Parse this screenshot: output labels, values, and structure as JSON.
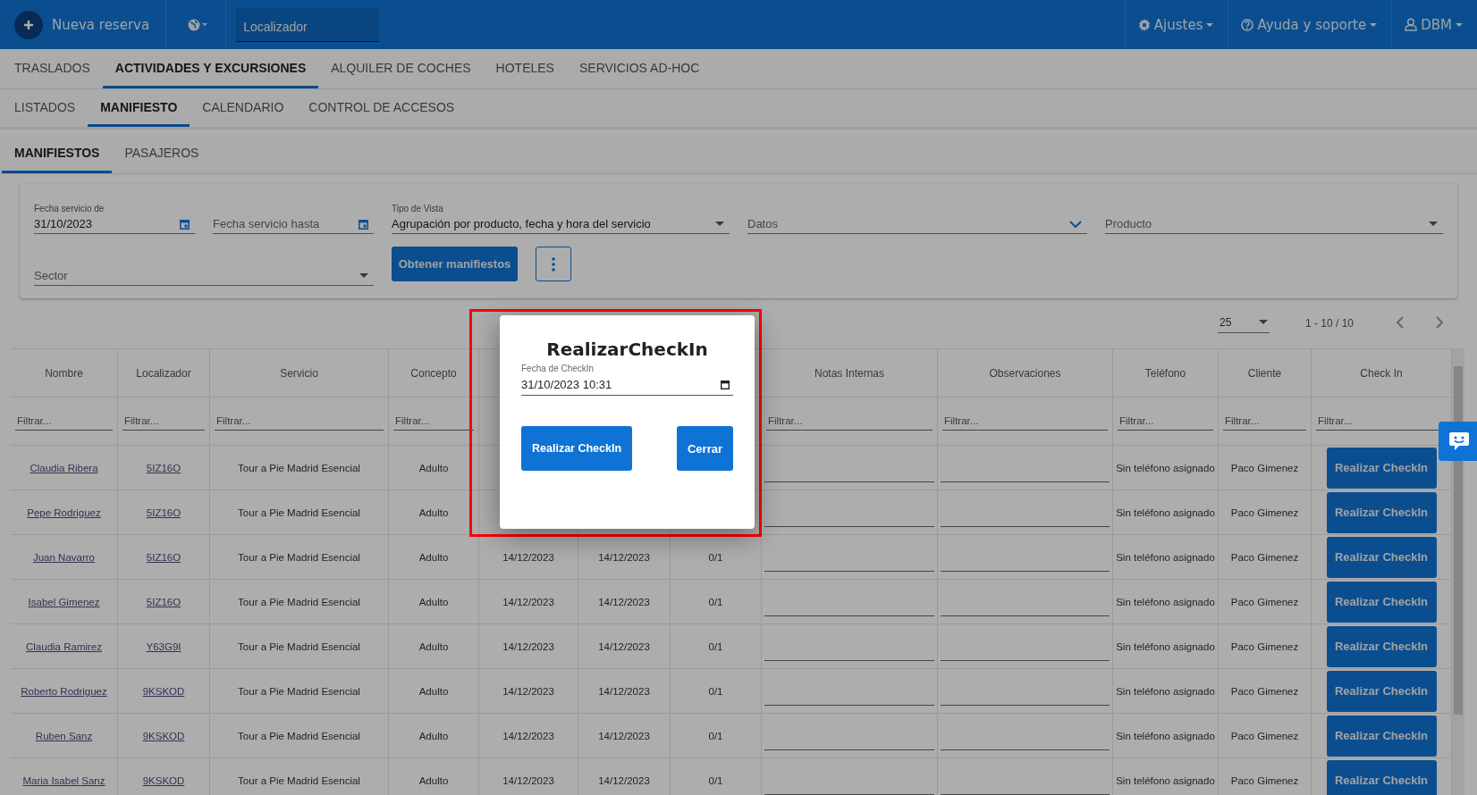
{
  "top_bar": {
    "new_button": "Nueva reserva",
    "search": {
      "placeholder": "Localizador"
    },
    "menus": [
      {
        "kind": "settings",
        "label": "Ajustes"
      },
      {
        "kind": "help",
        "label": "Ayuda y soporte"
      },
      {
        "kind": "user",
        "label": "DBM"
      }
    ]
  },
  "main_tabs": [
    {
      "label": "TRASLADOS",
      "selected": false
    },
    {
      "label": "ACTIVIDADES Y EXCURSIONES",
      "selected": true
    },
    {
      "label": "ALQUILER DE COCHES",
      "selected": false
    },
    {
      "label": "HOTELES",
      "selected": false
    },
    {
      "label": "SERVICIOS AD-HOC",
      "selected": false
    }
  ],
  "sub_tabs": [
    {
      "label": "LISTADOS",
      "selected": false
    },
    {
      "label": "MANIFIESTO",
      "selected": true
    },
    {
      "label": "CALENDARIO",
      "selected": false
    },
    {
      "label": "CONTROL DE ACCESOS",
      "selected": false
    }
  ],
  "section_tabs": [
    {
      "label": "MANIFIESTOS",
      "selected": true
    },
    {
      "label": "PASAJEROS",
      "selected": false
    }
  ],
  "filters": {
    "fields": [
      {
        "kind": "date",
        "label": "Fecha servicio de",
        "value": "31/10/2023"
      },
      {
        "kind": "date",
        "placeholder": "Fecha servicio hasta"
      },
      {
        "kind": "select",
        "label": "Tipo de Vista",
        "value": "Agrupación por producto, fecha y hora del servicio"
      },
      {
        "kind": "chevron",
        "placeholder": "Datos"
      },
      {
        "kind": "select",
        "placeholder": "Producto"
      },
      {
        "kind": "wide-select",
        "placeholder": "Sector"
      }
    ],
    "submit_button": "Obtener manifiestos"
  },
  "pagination": {
    "page_size": "25",
    "range": "1 - 10 / 10"
  },
  "table": {
    "columns_before": [
      {
        "heading": "Nombre",
        "filter_placeholder": "Filtrar..."
      },
      {
        "heading": "Localizador",
        "filter_placeholder": "Filtrar..."
      },
      {
        "heading": "Servicio",
        "filter_placeholder": "Filtrar..."
      },
      {
        "heading": "Concepto",
        "filter_placeholder": "Filtrar..."
      }
    ],
    "columns_after": [
      {
        "heading": "Notas Internas",
        "filter_placeholder": "Filtrar..."
      },
      {
        "heading": "Observaciones",
        "filter_placeholder": "Filtrar..."
      },
      {
        "heading": "Teléfono",
        "filter_placeholder": "Filtrar..."
      },
      {
        "heading": "Cliente",
        "filter_placeholder": "Filtrar..."
      },
      {
        "heading": "Check In",
        "filter_placeholder": "Filtrar..."
      }
    ],
    "rows": [
      {
        "nombre": "Claudia Ribera",
        "localizador": "5IZ16O",
        "servicio": "Tour a Pie Madrid Esencial",
        "concepto": "Adulto",
        "telefono": "Sin teléfono asignado",
        "cliente": "Paco Gimenez",
        "action": "Realizar CheckIn"
      },
      {
        "nombre": "Pepe Rodriguez",
        "localizador": "5IZ16O",
        "servicio": "Tour a Pie Madrid Esencial",
        "concepto": "Adulto",
        "telefono": "Sin teléfono asignado",
        "cliente": "Paco Gimenez",
        "action": "Realizar CheckIn"
      },
      {
        "nombre": "Juan Navarro",
        "localizador": "5IZ16O",
        "servicio": "Tour a Pie Madrid Esencial",
        "concepto": "Adulto",
        "column_5": "14/12/2023",
        "column_6": "14/12/2023",
        "column_7": "0/1",
        "telefono": "Sin teléfono asignado",
        "cliente": "Paco Gimenez",
        "action": "Realizar CheckIn"
      },
      {
        "nombre": "Isabel Gimenez",
        "localizador": "5IZ16O",
        "servicio": "Tour a Pie Madrid Esencial",
        "concepto": "Adulto",
        "column_5": "14/12/2023",
        "column_6": "14/12/2023",
        "column_7": "0/1",
        "telefono": "Sin teléfono asignado",
        "cliente": "Paco Gimenez",
        "action": "Realizar CheckIn"
      },
      {
        "nombre": "Claudia Ramirez",
        "localizador": "Y63G9I",
        "servicio": "Tour a Pie Madrid Esencial",
        "concepto": "Adulto",
        "column_5": "14/12/2023",
        "column_6": "14/12/2023",
        "column_7": "0/1",
        "telefono": "Sin teléfono asignado",
        "cliente": "Paco Gimenez",
        "action": "Realizar CheckIn"
      },
      {
        "nombre": "Roberto Rodriguez",
        "localizador": "9KSKOD",
        "servicio": "Tour a Pie Madrid Esencial",
        "concepto": "Adulto",
        "column_5": "14/12/2023",
        "column_6": "14/12/2023",
        "column_7": "0/1",
        "telefono": "Sin teléfono asignado",
        "cliente": "Paco Gimenez",
        "action": "Realizar CheckIn"
      },
      {
        "nombre": "Ruben Sanz",
        "localizador": "9KSKOD",
        "servicio": "Tour a Pie Madrid Esencial",
        "concepto": "Adulto",
        "column_5": "14/12/2023",
        "column_6": "14/12/2023",
        "column_7": "0/1",
        "telefono": "Sin teléfono asignado",
        "cliente": "Paco Gimenez",
        "action": "Realizar CheckIn"
      },
      {
        "nombre": "Maria Isabel Sanz",
        "localizador": "9KSKOD",
        "servicio": "Tour a Pie Madrid Esencial",
        "concepto": "Adulto",
        "column_5": "14/12/2023",
        "column_6": "14/12/2023",
        "column_7": "0/1",
        "telefono": "Sin teléfono asignado",
        "cliente": "Paco Gimenez",
        "action": "Realizar CheckIn"
      }
    ]
  },
  "dialog": {
    "title": "RealizarCheckIn",
    "field": {
      "label": "Fecha de CheckIn",
      "value": "31/10/2023 10:31"
    },
    "buttons": [
      {
        "kind": "primary",
        "label": "Realizar CheckIn"
      },
      {
        "kind": "secondary",
        "label": "Cerrar"
      }
    ]
  }
}
